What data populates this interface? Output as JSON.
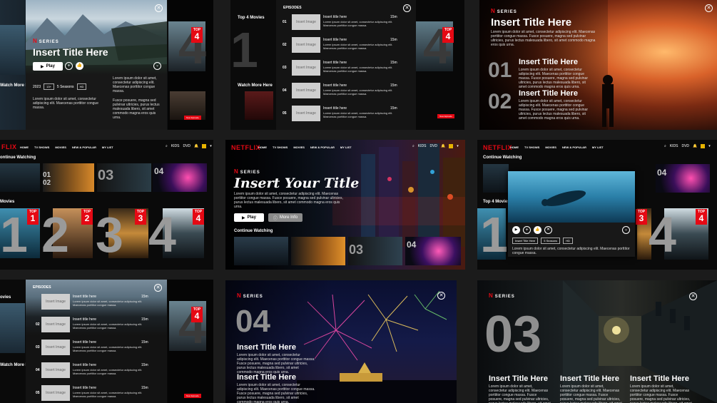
{
  "brand": {
    "logo": "NETFLIX",
    "series_label": "SERIES",
    "n_glyph": "N"
  },
  "colors": {
    "accent": "#e50914",
    "background": "#1b1b1b"
  },
  "nav": {
    "items": [
      "HOME",
      "TV SHOWS",
      "MOVIES",
      "NEW & POPULAR",
      "MY LIST"
    ],
    "kids": "KIDS",
    "dvd": "DVD"
  },
  "common": {
    "insert_title": "Insert Title Here",
    "lorem_long": "Lorem ipsum dolor sit amet, consectetur adipiscing elit. Maecenas porttitor congue massa. Fusce posuere, magna sed pulvinar ultricies, purus lectus malesuada libero, sit amet commodo magna eros quis urna.",
    "lorem_short": "Lorem ipsum dolor sit amet, consectetur adipiscing elit. Maecenas porttitor congue massa.",
    "lorem_mid": "Lorem ipsum dolor sit amet, consectetur adipiscing elit. Maecenas porttitor congue massa. Fusce posuere, magna sed pulvinar ultricies, purus lectus malesuada libero, sit amet commodo magna eros quis urna.",
    "lorem_fusce": "Fusce posuere, magna sed pulvinar ultricies, purus lectus malesuada libero, sit amet commodo magna eros quis urna.",
    "play": "Play",
    "more_info": "More Info",
    "close": "✕",
    "top4_movies": "Top 4 Movies",
    "movies": "Movies",
    "watch_more": "Watch More Here",
    "continue_watching": "Continue Watching",
    "ontinue_watching": "ontinue Watching",
    "insert_image": "Insert Image",
    "episodes": "EPISODES",
    "insert_title_here": "Insert title here",
    "ep_duration": "15m",
    "top": "TOP"
  },
  "tile1": {
    "year": "2023",
    "rating": "13+",
    "seasons": "5 Seasons",
    "quality": "HD",
    "watch_more": "Watch More Here",
    "ovies": "ovies"
  },
  "tile2": {
    "episodes": [
      "01",
      "02",
      "03",
      "04",
      "05"
    ]
  },
  "tile3": {
    "numbers": [
      "01",
      "02"
    ]
  },
  "tile4": {
    "rank_numbers": [
      "1",
      "2",
      "3",
      "4"
    ],
    "cw_numbers": [
      "01",
      "02",
      "03",
      "04"
    ]
  },
  "tile5": {
    "title": "Insert Your Title",
    "cw_numbers": [
      "03",
      "04"
    ]
  },
  "tile6": {
    "chips": [
      "Insert Title Here",
      "5 Seasons",
      "HD"
    ],
    "rank_numbers": [
      "3",
      "4"
    ],
    "cw_number": "04"
  },
  "tile7": {
    "episodes": [
      "02",
      "03",
      "04",
      "05"
    ]
  },
  "tile8": {
    "number": "04"
  },
  "tile9": {
    "number": "03"
  }
}
